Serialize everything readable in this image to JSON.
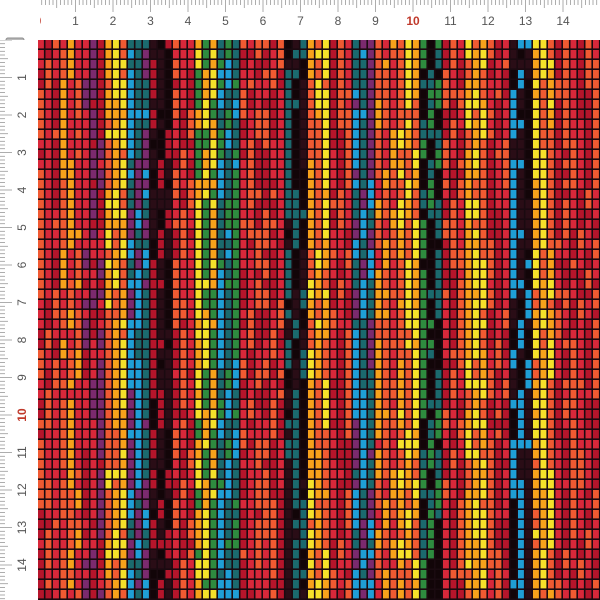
{
  "ruler": {
    "top_labels": [
      "0",
      "1",
      "2",
      "3",
      "4",
      "5",
      "6",
      "7",
      "8",
      "9",
      "10",
      "11",
      "12",
      "13",
      "14"
    ],
    "left_labels": [
      "1",
      "2",
      "3",
      "4",
      "5",
      "6",
      "7",
      "8",
      "9",
      "10",
      "11",
      "12",
      "13",
      "14"
    ],
    "accent_label": "10",
    "accent_color": "#c0392b",
    "label_color": "#555555",
    "tick_color": "#8a8a8a"
  },
  "fabric": {
    "palette": {
      "red": "#d8283a",
      "crimson": "#b5152b",
      "orange": "#f05a32",
      "amber": "#f7a21b",
      "yellow": "#f5e12a",
      "blue": "#1f9fd6",
      "teal": "#1b6a6e",
      "green": "#2e8b3f",
      "purple": "#7b2a6e",
      "dark": "#2a0d16",
      "black": "#120508"
    },
    "background": "#1a0a10"
  }
}
